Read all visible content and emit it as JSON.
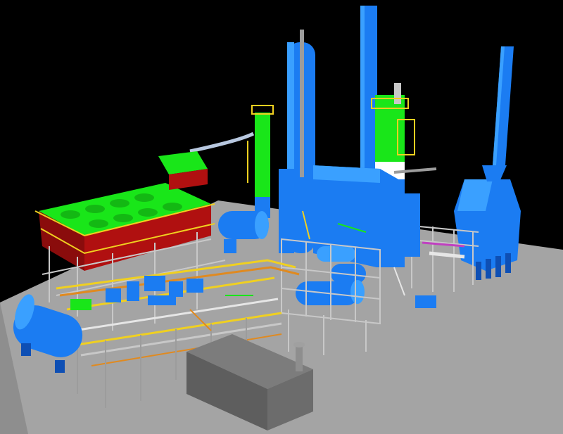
{
  "scene": {
    "description_visible_text": "",
    "palette": {
      "background": "#000000",
      "floor": "#a6a6a6",
      "floor_shadow": "#8c8c8c",
      "equipment_blue": "#1b7cf2",
      "equipment_blue_light": "#3aa0ff",
      "equipment_blue_dark": "#0e4fb4",
      "structure_green": "#19e619",
      "structure_red": "#b01010",
      "steel_grey": "#8e8e8e",
      "steel_light": "#c8c8c8",
      "piping_yellow": "#f0d020",
      "piping_orange": "#e08a20",
      "piping_white": "#e6e6e6",
      "piping_magenta": "#c040c0",
      "building_grey": "#6c6c6c"
    }
  }
}
